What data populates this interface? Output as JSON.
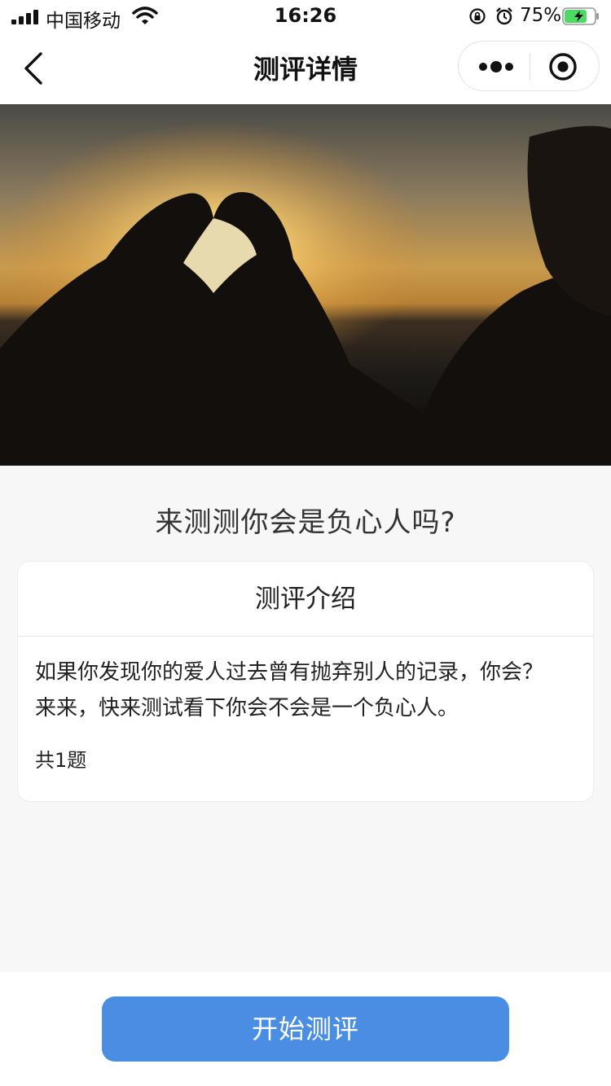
{
  "status_bar": {
    "carrier": "中国移动",
    "time": "16:26",
    "battery": "75%",
    "battery_level": 0.75
  },
  "nav": {
    "title": "测评详情",
    "icons": [
      "back-icon",
      "more-icon",
      "close-target-icon"
    ]
  },
  "banner": {
    "image": "hands-heart-sunset-photo"
  },
  "quiz": {
    "title": "来测测你会是负心人吗?"
  },
  "intro": {
    "header": "测评介绍",
    "description": "如果你发现你的爱人过去曾有抛弃别人的记录，你会？来来，快来测试看下你会不会是一个负心人。",
    "count": "共1题"
  },
  "actions": {
    "start_label": "开始测评"
  },
  "colors": {
    "accent": "#4a8ee4",
    "background": "#f7f7f7",
    "battery_fill": "#4cd964"
  }
}
